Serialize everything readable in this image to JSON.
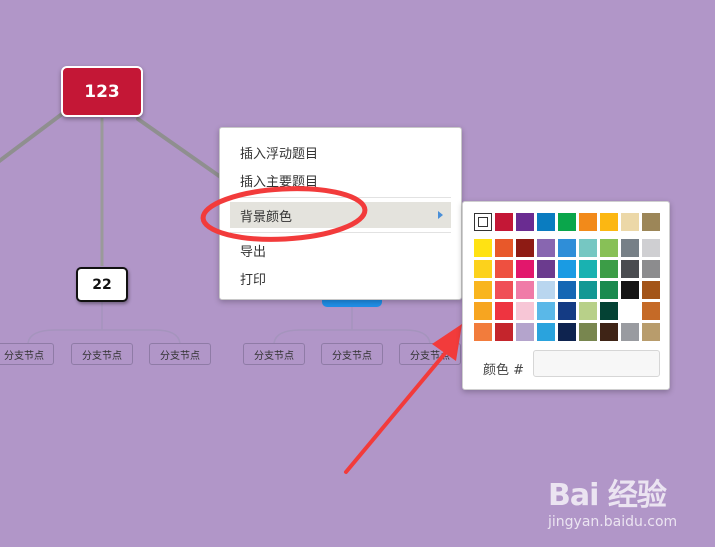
{
  "mindmap": {
    "root_node": {
      "label": "123",
      "color": "#c41736"
    },
    "child_node": {
      "label": "22"
    },
    "leaf_nodes": [
      "分支节点",
      "分支节点",
      "分支节点",
      "分支节点",
      "分支节点",
      "分支节点"
    ],
    "background": "#b196c8"
  },
  "context_menu": {
    "items": [
      {
        "label": "插入浮动题目"
      },
      {
        "label": "插入主要题目"
      },
      {
        "label": "背景颜色",
        "has_submenu": true,
        "active": true
      },
      {
        "label": "导出"
      },
      {
        "label": "打印"
      }
    ]
  },
  "color_picker": {
    "top_row": [
      "#c41736",
      "#6a2c91",
      "#0a7cc0",
      "#0aa64b",
      "#f28a1a",
      "#fcb712",
      "#ecd8a8",
      "#9c8658"
    ],
    "grid": [
      [
        "#ffe213",
        "#e8582a",
        "#8e1b14",
        "#8866b0",
        "#2f8ed8",
        "#76c7c2",
        "#88c057",
        "#778087",
        "#cfcfd2"
      ],
      [
        "#fcd21c",
        "#ee5040",
        "#e2176c",
        "#6b3b8e",
        "#1a9be3",
        "#19b2b1",
        "#3c9d47",
        "#4a4c50",
        "#8c8c8e"
      ],
      [
        "#f9b51e",
        "#f04e57",
        "#f07ba8",
        "#b9d6ef",
        "#1567b4",
        "#149894",
        "#1a8a4e",
        "#141414",
        "#a35418"
      ],
      [
        "#f7a520",
        "#ee3440",
        "#f7c6d6",
        "#5ab8e8",
        "#143b84",
        "#b8d089",
        "#044234",
        "#ffffff",
        "#c56a27"
      ],
      [
        "#f27c3c",
        "#c4252c",
        "#b4a4cc",
        "#2aa3dd",
        "#0e234f",
        "#78864f",
        "#3f2416",
        "#999ba0",
        "#b89c6c"
      ]
    ],
    "label": "颜色 #",
    "value": ""
  },
  "watermark": {
    "brand": "Bai  经验",
    "url": "jingyan.baidu.com"
  }
}
